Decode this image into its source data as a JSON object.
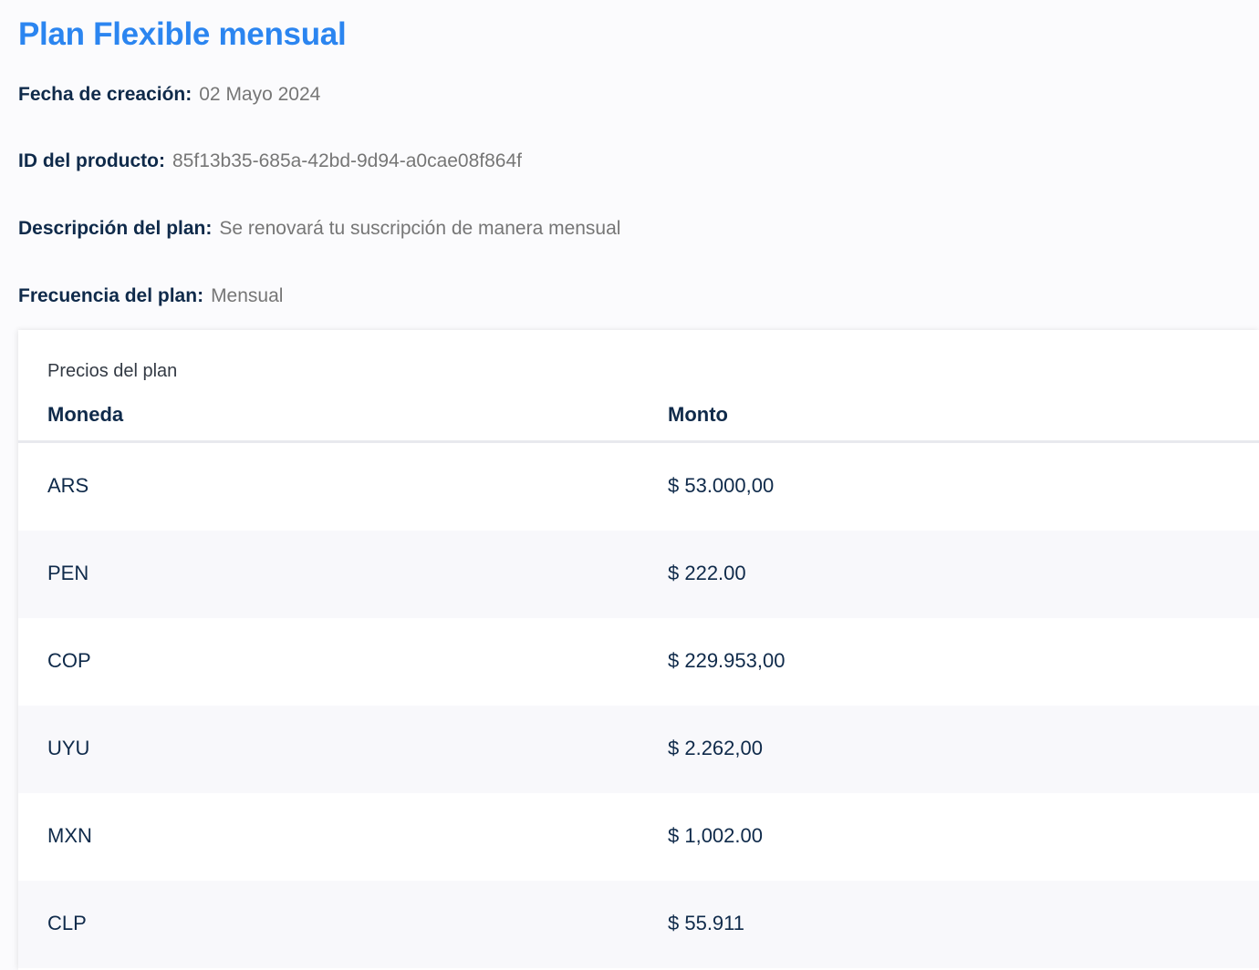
{
  "plan": {
    "title": "Plan Flexible mensual",
    "fecha_label": "Fecha de creación:",
    "fecha_value": "02 Mayo 2024",
    "id_label": "ID del producto:",
    "id_value": "85f13b35-685a-42bd-9d94-a0cae08f864f",
    "desc_label": "Descripción del plan:",
    "desc_value": "Se renovará tu suscripción de manera mensual",
    "freq_label": "Frecuencia del plan:",
    "freq_value": "Mensual"
  },
  "prices": {
    "caption": "Precios del plan",
    "headers": {
      "currency": "Moneda",
      "amount": "Monto"
    },
    "rows": [
      {
        "currency": "ARS",
        "amount": "$ 53.000,00"
      },
      {
        "currency": "PEN",
        "amount": "$ 222.00"
      },
      {
        "currency": "COP",
        "amount": "$ 229.953,00"
      },
      {
        "currency": "UYU",
        "amount": "$ 2.262,00"
      },
      {
        "currency": "MXN",
        "amount": "$ 1,002.00"
      },
      {
        "currency": "CLP",
        "amount": "$ 55.911"
      }
    ]
  },
  "colors": {
    "title": "#2b85f0",
    "label": "#0f2a4a",
    "value": "#767676",
    "row_alt": "#f8f8fb"
  }
}
